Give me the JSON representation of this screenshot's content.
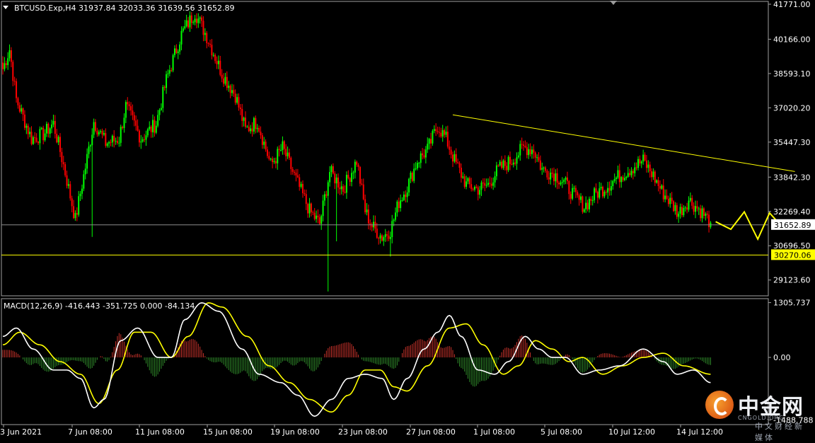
{
  "chart_data": [
    {
      "type": "candlestick",
      "symbol_header": "BTCUSD.Exp,H4  31937.84 32033.36 31639.56 31652.89",
      "ylim": [
        28400,
        41900
      ],
      "y_ticks": [
        "41771.00",
        "40166.00",
        "38593.10",
        "37020.20",
        "35447.30",
        "33842.30",
        "32269.40",
        "30696.50",
        "29123.60"
      ],
      "x_ticks": [
        "3 Jun 2021",
        "7 Jun 08:00",
        "11 Jun 08:00",
        "15 Jun 08:00",
        "19 Jun 08:00",
        "23 Jun 08:00",
        "27 Jun 08:00",
        "1 Jul 08:00",
        "5 Jul 08:00",
        "10 Jul 12:00",
        "14 Jul 12:00"
      ],
      "up_color": "#00ff00",
      "down_color": "#ff0000",
      "anchors": [
        [
          0,
          38800
        ],
        [
          4,
          39700
        ],
        [
          8,
          37400
        ],
        [
          13,
          36400
        ],
        [
          17,
          35600
        ],
        [
          24,
          35800
        ],
        [
          30,
          36300
        ],
        [
          36,
          34400
        ],
        [
          43,
          31900
        ],
        [
          49,
          34300
        ],
        [
          54,
          36400
        ],
        [
          61,
          35400
        ],
        [
          69,
          35600
        ],
        [
          73,
          37100
        ],
        [
          82,
          35600
        ],
        [
          91,
          36300
        ],
        [
          97,
          38300
        ],
        [
          106,
          40400
        ],
        [
          114,
          41400
        ],
        [
          121,
          40300
        ],
        [
          130,
          38600
        ],
        [
          138,
          37600
        ],
        [
          144,
          36000
        ],
        [
          151,
          36400
        ],
        [
          159,
          34400
        ],
        [
          166,
          35200
        ],
        [
          173,
          33900
        ],
        [
          182,
          32300
        ],
        [
          188,
          31700
        ],
        [
          194,
          34100
        ],
        [
          202,
          33300
        ],
        [
          210,
          34600
        ],
        [
          215,
          32300
        ],
        [
          219,
          31600
        ],
        [
          225,
          31100
        ],
        [
          230,
          31400
        ],
        [
          235,
          32700
        ],
        [
          240,
          33400
        ],
        [
          246,
          34600
        ],
        [
          252,
          35100
        ],
        [
          258,
          36200
        ],
        [
          263,
          35600
        ],
        [
          268,
          34600
        ],
        [
          275,
          33500
        ],
        [
          282,
          33300
        ],
        [
          288,
          33500
        ],
        [
          294,
          34200
        ],
        [
          302,
          34600
        ],
        [
          309,
          35200
        ],
        [
          315,
          35100
        ],
        [
          320,
          34200
        ],
        [
          327,
          34000
        ],
        [
          333,
          33600
        ],
        [
          339,
          33000
        ],
        [
          345,
          32500
        ],
        [
          352,
          33100
        ],
        [
          358,
          33400
        ],
        [
          364,
          33800
        ],
        [
          372,
          34200
        ],
        [
          380,
          34600
        ],
        [
          386,
          33900
        ],
        [
          391,
          33200
        ],
        [
          396,
          32700
        ],
        [
          401,
          32200
        ],
        [
          407,
          32800
        ],
        [
          414,
          32300
        ],
        [
          420,
          31752
        ]
      ],
      "spikes": [
        [
          193,
          28600
        ],
        [
          230,
          30200
        ],
        [
          53,
          31100
        ],
        [
          198,
          30900
        ]
      ],
      "trendline": {
        "x": [
          267,
          470
        ],
        "y": [
          36700,
          34100
        ],
        "color": "#ffff00"
      },
      "current_price": {
        "label": "31652.89",
        "value": 31652.89,
        "color": "#c8c8c8"
      },
      "support": {
        "label": "30270.06",
        "value": 30270.06,
        "color": "#ffff00"
      },
      "forecast_path": {
        "x": [
          423,
          432,
          440,
          448,
          455,
          462
        ],
        "y": [
          31800,
          31450,
          32250,
          31000,
          32200,
          31600
        ],
        "color": "#ffff00"
      }
    },
    {
      "type": "macd",
      "header": "MACD(12,26,9) -416.443 -351.725 0.000 -84.134",
      "ylim": [
        -1600,
        1400
      ],
      "y_ticks": [
        "1305.737",
        "0.00",
        "-1488.788"
      ],
      "macd_color": "#ffffff",
      "signal_color": "#ffff00",
      "macd_anchors": [
        [
          0,
          500
        ],
        [
          8,
          700
        ],
        [
          18,
          200
        ],
        [
          30,
          -300
        ],
        [
          38,
          -300
        ],
        [
          46,
          -500
        ],
        [
          54,
          -1200
        ],
        [
          60,
          -1000
        ],
        [
          70,
          400
        ],
        [
          80,
          700
        ],
        [
          92,
          0
        ],
        [
          100,
          0
        ],
        [
          108,
          900
        ],
        [
          118,
          1300
        ],
        [
          128,
          1100
        ],
        [
          142,
          200
        ],
        [
          152,
          -400
        ],
        [
          165,
          -600
        ],
        [
          175,
          -900
        ],
        [
          185,
          -1400
        ],
        [
          195,
          -1000
        ],
        [
          205,
          -500
        ],
        [
          215,
          -400
        ],
        [
          225,
          -500
        ],
        [
          232,
          -1000
        ],
        [
          240,
          -500
        ],
        [
          250,
          200
        ],
        [
          258,
          600
        ],
        [
          265,
          1000
        ],
        [
          272,
          500
        ],
        [
          282,
          -300
        ],
        [
          292,
          -400
        ],
        [
          300,
          -100
        ],
        [
          310,
          500
        ],
        [
          318,
          200
        ],
        [
          326,
          0
        ],
        [
          334,
          0
        ],
        [
          344,
          -400
        ],
        [
          354,
          -300
        ],
        [
          366,
          -200
        ],
        [
          380,
          200
        ],
        [
          392,
          -100
        ],
        [
          400,
          -400
        ],
        [
          410,
          -300
        ],
        [
          420,
          -600
        ]
      ],
      "signal_anchors": [
        [
          0,
          300
        ],
        [
          10,
          600
        ],
        [
          22,
          300
        ],
        [
          34,
          -100
        ],
        [
          46,
          -400
        ],
        [
          57,
          -1100
        ],
        [
          68,
          -300
        ],
        [
          78,
          600
        ],
        [
          88,
          600
        ],
        [
          100,
          0
        ],
        [
          110,
          500
        ],
        [
          122,
          1300
        ],
        [
          130,
          1200
        ],
        [
          145,
          500
        ],
        [
          158,
          -200
        ],
        [
          170,
          -600
        ],
        [
          182,
          -1000
        ],
        [
          195,
          -1300
        ],
        [
          205,
          -900
        ],
        [
          215,
          -300
        ],
        [
          224,
          -300
        ],
        [
          232,
          -700
        ],
        [
          240,
          -800
        ],
        [
          252,
          -200
        ],
        [
          265,
          700
        ],
        [
          275,
          800
        ],
        [
          285,
          300
        ],
        [
          297,
          -400
        ],
        [
          306,
          -200
        ],
        [
          316,
          400
        ],
        [
          326,
          200
        ],
        [
          336,
          -100
        ],
        [
          344,
          0
        ],
        [
          356,
          -400
        ],
        [
          368,
          -200
        ],
        [
          380,
          0
        ],
        [
          392,
          100
        ],
        [
          404,
          -200
        ],
        [
          420,
          -400
        ]
      ]
    }
  ],
  "watermark": {
    "cn": "中金网",
    "en": "CNGOLD.ORG",
    "sub": "中文财经新媒体"
  }
}
